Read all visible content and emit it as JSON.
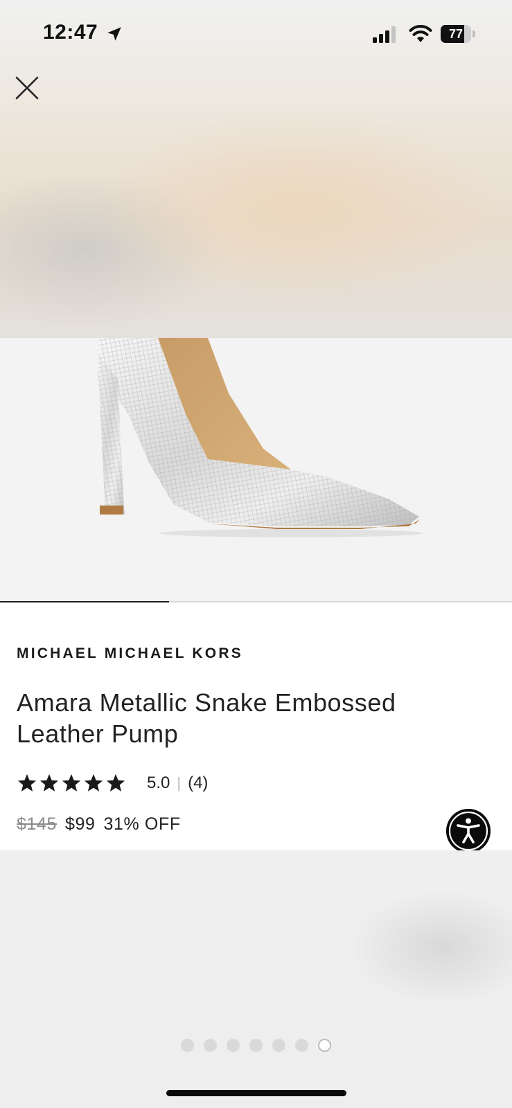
{
  "status_bar": {
    "time": "12:47",
    "battery_text": "77",
    "battery_level": 0.77
  },
  "icons": {
    "close": "close-icon",
    "location": "location-arrow-icon",
    "accessibility": "accessibility-icon"
  },
  "carousel": {
    "progress": 0.33,
    "slide_count": 7,
    "active_slide": 7
  },
  "product": {
    "brand": "MICHAEL MICHAEL KORS",
    "name": "Amara Metallic Snake Embossed Leather Pump",
    "rating": {
      "value": "5.0",
      "separator": "|",
      "count": "(4)",
      "stars": 5
    },
    "price": {
      "original": "$145",
      "sale": "$99",
      "discount": "31% OFF"
    }
  }
}
